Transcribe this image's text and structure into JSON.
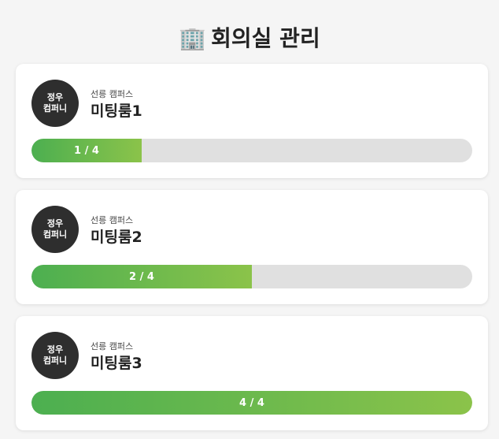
{
  "page": {
    "title_icon": "office-building-icon",
    "title_emoji": "🏢",
    "title": "회의실 관리"
  },
  "colors": {
    "background": "#f5f5f5",
    "card": "#ffffff",
    "avatar": "#2e2e2e",
    "track": "#e0e0e0",
    "fill_start": "#4caf50",
    "fill_end": "#8bc34a"
  },
  "rooms": [
    {
      "company_line1": "정우",
      "company_line2": "컴퍼니",
      "campus": "선릉 캠퍼스",
      "name": "미팅룸1",
      "occupancy_label": "1 / 4",
      "occupied": 1,
      "capacity": 4
    },
    {
      "company_line1": "정우",
      "company_line2": "컴퍼니",
      "campus": "선릉 캠퍼스",
      "name": "미팅룸2",
      "occupancy_label": "2 / 4",
      "occupied": 2,
      "capacity": 4
    },
    {
      "company_line1": "정우",
      "company_line2": "컴퍼니",
      "campus": "선릉 캠퍼스",
      "name": "미팅룸3",
      "occupancy_label": "4 / 4",
      "occupied": 4,
      "capacity": 4
    }
  ]
}
